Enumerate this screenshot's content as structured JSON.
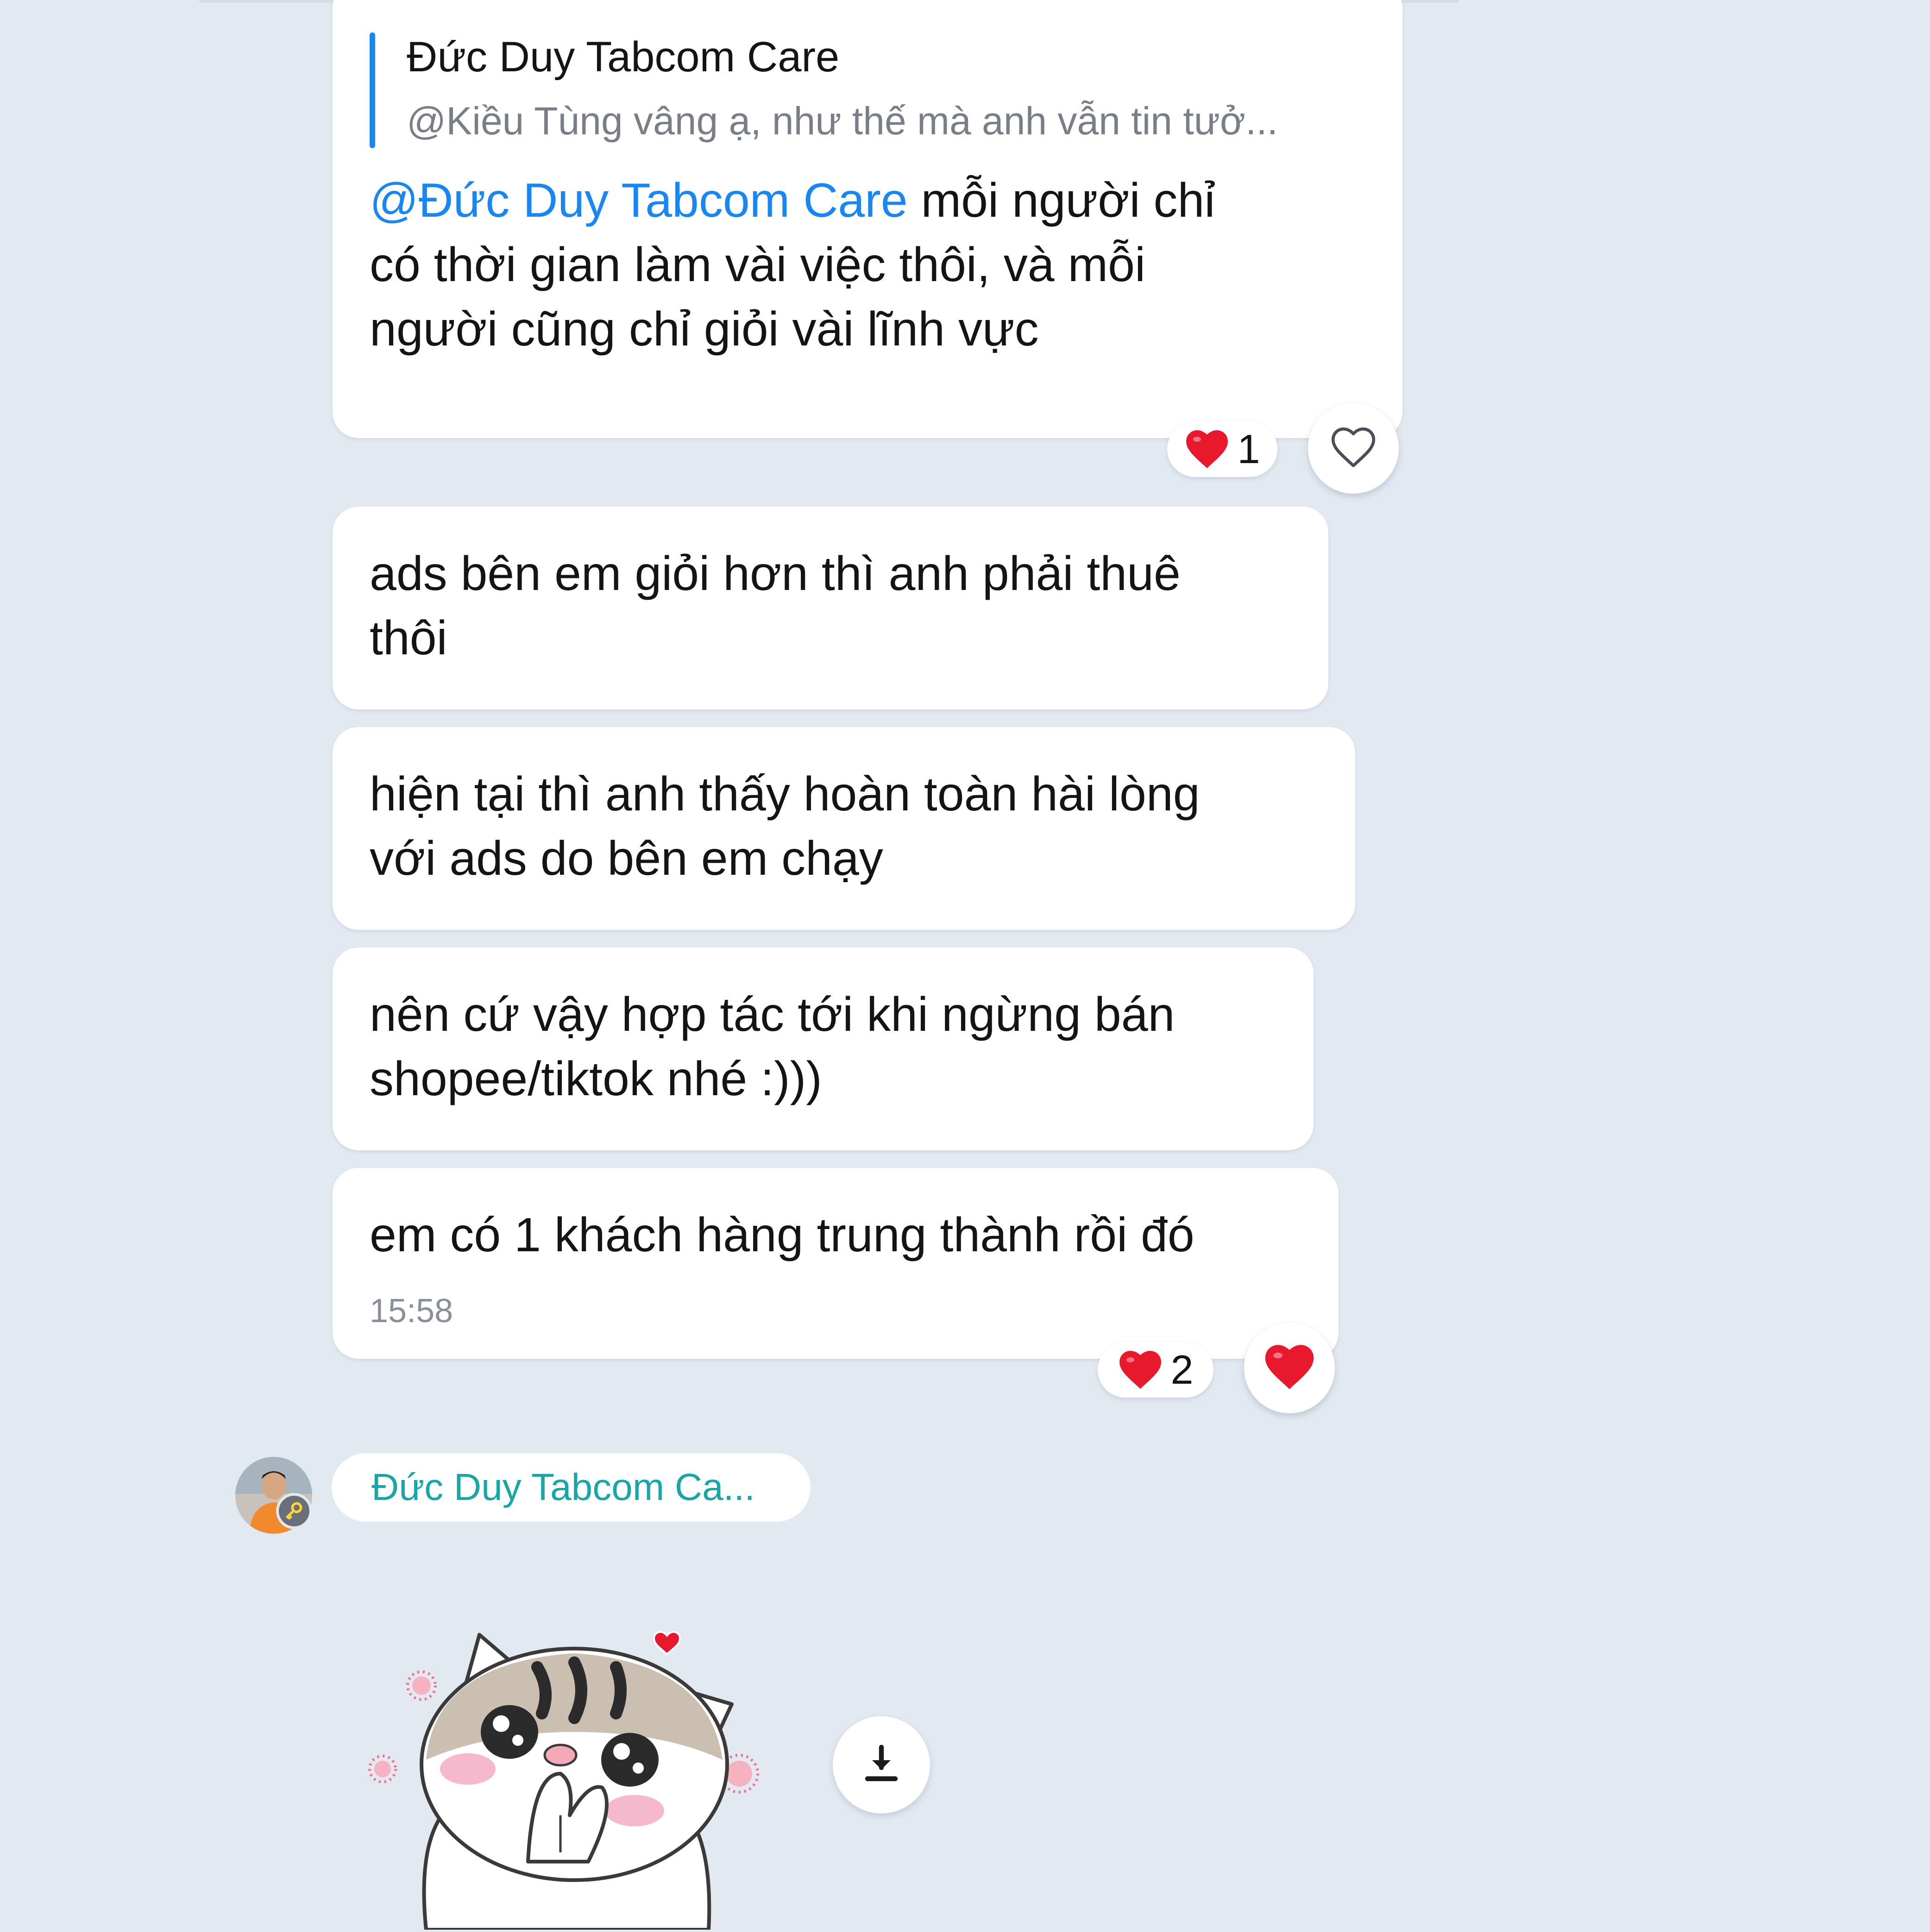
{
  "messages": [
    {
      "reply": {
        "name": "Đức Duy Tabcom Care",
        "snippet": "@Kiều Tùng vâng ạ, như thế mà anh vẫn tin tưở..."
      },
      "mention": "@Đức Duy Tabcom Care",
      "text": " mỗi người chỉ\ncó thời gian làm vài việc thôi, và mỗi\nngười cũng chỉ giỏi vài lĩnh vực",
      "reaction": {
        "emoji": "heart-icon",
        "count": "1"
      },
      "react_button": "heart-outline-icon"
    },
    {
      "text": "ads bên em giỏi hơn thì anh phải thuê\nthôi"
    },
    {
      "text": "hiện tại thì anh thấy hoàn toàn hài lòng\nvới ads do bên em chạy"
    },
    {
      "text": "nên cứ vậy hợp tác tới khi ngừng bán\nshopee/tiktok nhé :)))"
    },
    {
      "text": "em có 1 khách hàng trung thành rồi đó",
      "time": "15:58",
      "reaction": {
        "emoji": "heart-icon",
        "count": "2"
      },
      "react_button": "heart-filled-icon"
    }
  ],
  "sender": {
    "name": "Đức Duy Tabcom Ca...",
    "avatar": "avatar",
    "badge": "key-icon"
  },
  "sticker": {
    "icon": "cat-sticker"
  },
  "download": {
    "icon": "download-icon"
  },
  "colors": {
    "background": "#e3e9f1",
    "bubble": "#ffffff",
    "mention": "#1a86f0",
    "reply_bar": "#1a86f0",
    "sender_name": "#1aa6a6",
    "heart": "#e8192c"
  }
}
